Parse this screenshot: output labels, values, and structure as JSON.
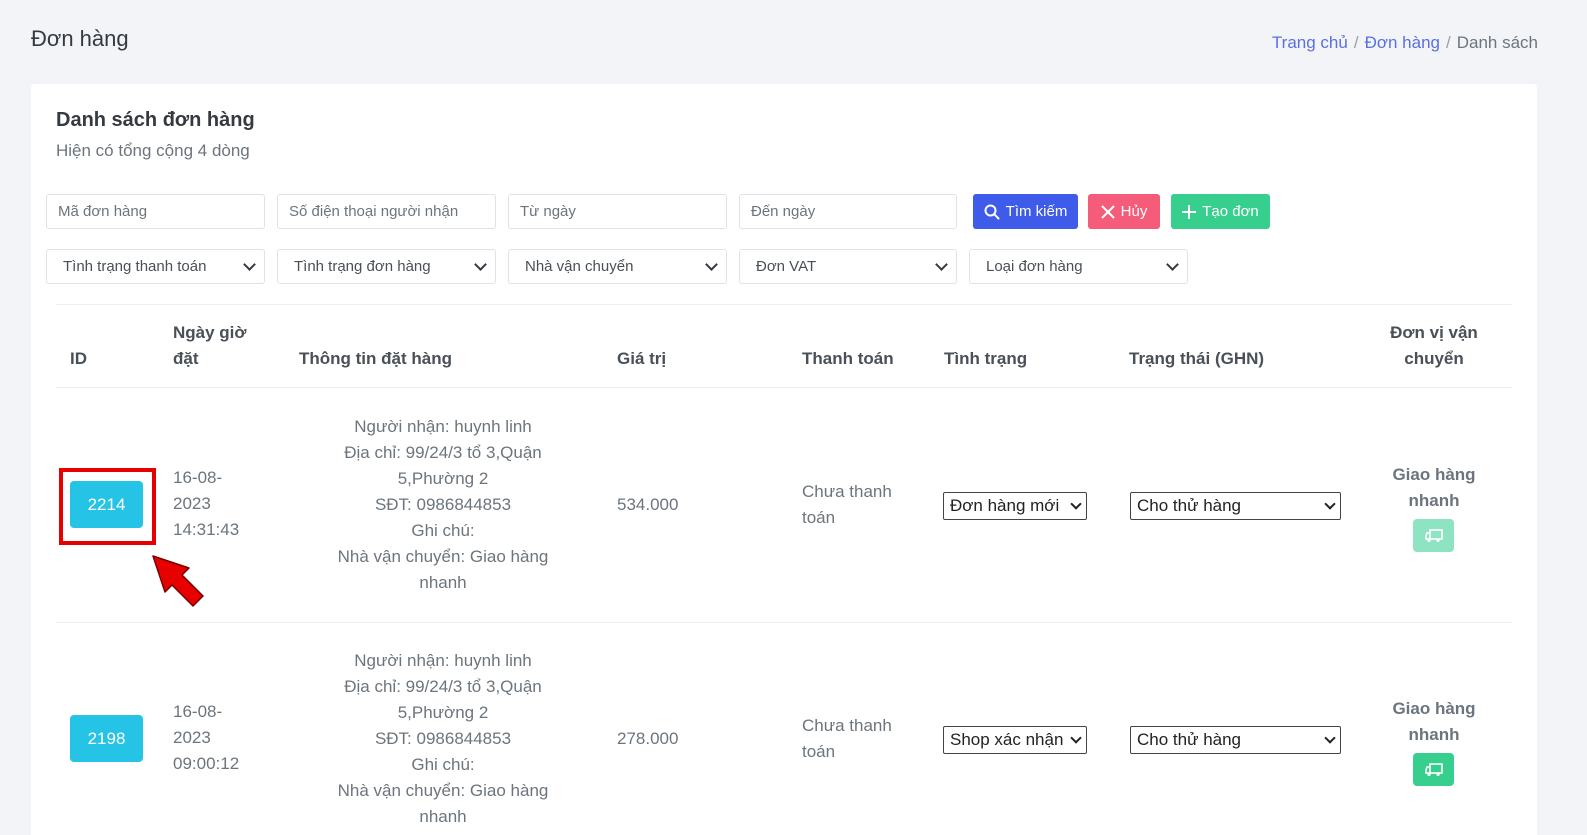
{
  "header": {
    "page_title": "Đơn hàng",
    "breadcrumb": {
      "home": "Trang chủ",
      "section": "Đơn hàng",
      "current": "Danh sách",
      "sep1": "/",
      "sep2": "/"
    }
  },
  "card": {
    "title": "Danh sách đơn hàng",
    "subtitle": "Hiện có tổng cộng 4 dòng"
  },
  "filters": {
    "order_id_placeholder": "Mã đơn hàng",
    "phone_placeholder": "Số điện thoại người nhận",
    "from_date_placeholder": "Từ ngày",
    "to_date_placeholder": "Đến ngày",
    "payment_status": "Tình trạng thanh toán",
    "order_status": "Tình trạng đơn hàng",
    "shipper": "Nhà vận chuyển",
    "vat": "Đơn VAT",
    "order_type": "Loại đơn hàng"
  },
  "buttons": {
    "search": "Tìm kiếm",
    "cancel": "Hủy",
    "create": "Tạo đơn"
  },
  "table": {
    "headers": {
      "id": "ID",
      "date_l1": "Ngày giờ",
      "date_l2": "đặt",
      "info": "Thông tin đặt hàng",
      "value": "Giá trị",
      "payment": "Thanh toán",
      "status": "Tình trạng",
      "ghn": "Trạng thái (GHN)",
      "carrier_l1": "Đơn vị vận",
      "carrier_l2": "chuyển"
    },
    "rows": [
      {
        "id": "2214",
        "date_l1": "16-08-",
        "date_l2": "2023",
        "date_l3": "14:31:43",
        "info_l1": "Người nhận: huynh linh",
        "info_l2": "Địa chỉ: 99/24/3 tổ 3,Quận",
        "info_l3": "5,Phường 2",
        "info_l4": "SĐT: 0986844853",
        "info_l5": "Ghi chú:",
        "info_l6": "Nhà vận chuyển: Giao hàng",
        "info_l7": "nhanh",
        "value": "534.000",
        "payment_l1": "Chưa thanh",
        "payment_l2": "toán",
        "status": "Đơn hàng mới",
        "ghn": "Cho thử hàng",
        "carrier_l1": "Giao hàng",
        "carrier_l2": "nhanh",
        "truck_color": "#8ee3c3"
      },
      {
        "id": "2198",
        "date_l1": "16-08-",
        "date_l2": "2023",
        "date_l3": "09:00:12",
        "info_l1": "Người nhận: huynh linh",
        "info_l2": "Địa chỉ: 99/24/3 tổ 3,Quận",
        "info_l3": "5,Phường 2",
        "info_l4": "SĐT: 0986844853",
        "info_l5": "Ghi chú:",
        "info_l6": "Nhà vận chuyển: Giao hàng",
        "info_l7": "nhanh",
        "value": "278.000",
        "payment_l1": "Chưa thanh",
        "payment_l2": "toán",
        "status": "Shop xác nhận",
        "ghn": "Cho thử hàng",
        "carrier_l1": "Giao hàng",
        "carrier_l2": "nhanh",
        "truck_color": "#37cf8e"
      }
    ]
  },
  "colors": {
    "primary": "#3f5be9",
    "danger": "#f55c7a",
    "success": "#37cf8e",
    "info": "#25c3e6",
    "annotation": "#e60000"
  },
  "icons": {
    "search": "search-icon",
    "cancel": "close-icon",
    "create": "plus-icon",
    "truck": "truck-icon",
    "arrow": "pointer-arrow-icon"
  }
}
